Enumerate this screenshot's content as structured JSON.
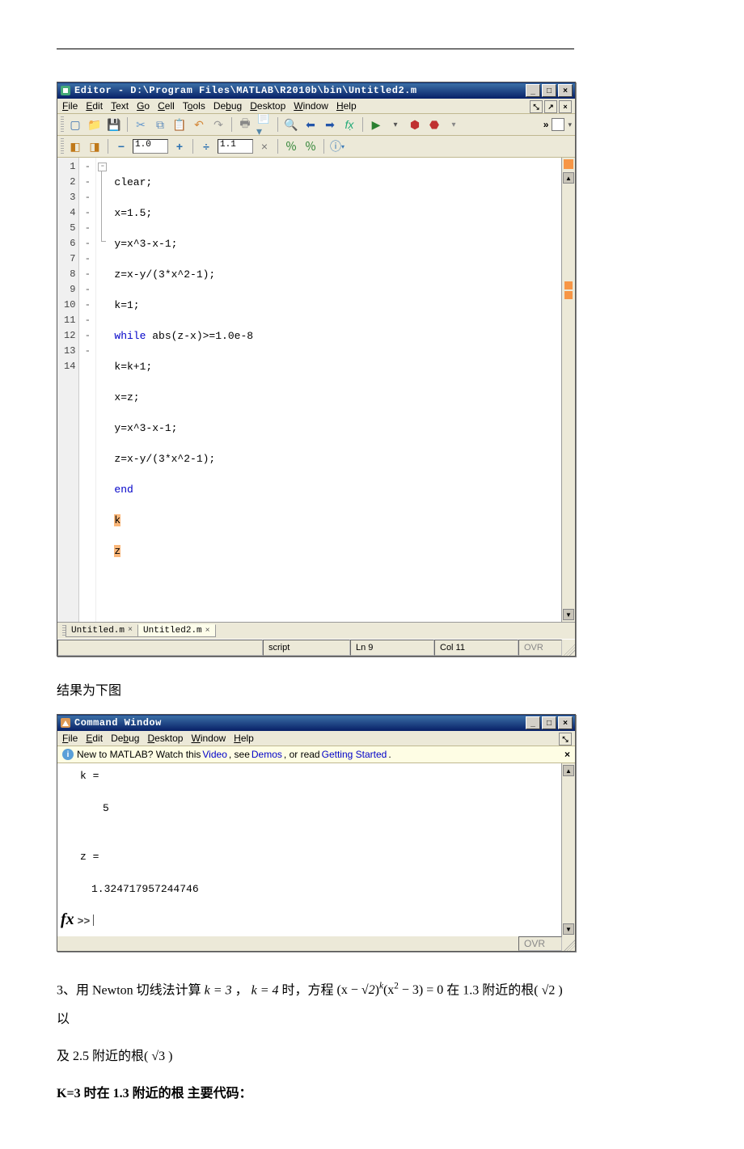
{
  "editor": {
    "title": "Editor - D:\\Program Files\\MATLAB\\R2010b\\bin\\Untitled2.m",
    "menus": [
      "File",
      "Edit",
      "Text",
      "Go",
      "Cell",
      "Tools",
      "Debug",
      "Desktop",
      "Window",
      "Help"
    ],
    "cell_in_1": "1.0",
    "cell_in_2": "1.1",
    "chevron": "»",
    "code_lines": [
      {
        "n": "1",
        "dash": "-",
        "fold": "",
        "text": "clear;",
        "hl": ""
      },
      {
        "n": "2",
        "dash": "-",
        "fold": "",
        "text": "x=1.5;",
        "hl": ""
      },
      {
        "n": "3",
        "dash": "-",
        "fold": "",
        "text": "y=x^3-x-1;",
        "hl": ""
      },
      {
        "n": "4",
        "dash": "-",
        "fold": "",
        "text": "z=x-y/(3*x^2-1);",
        "hl": ""
      },
      {
        "n": "5",
        "dash": "-",
        "fold": "",
        "text": "k=1;",
        "hl": ""
      },
      {
        "n": "6",
        "dash": "-",
        "fold": "⊟",
        "pre": "",
        "kw": "while",
        "post": " abs(z-x)>=1.0e-8",
        "hl": ""
      },
      {
        "n": "7",
        "dash": "-",
        "fold": "│",
        "text": "k=k+1;",
        "hl": ""
      },
      {
        "n": "8",
        "dash": "-",
        "fold": "│",
        "text": "x=z;",
        "hl": ""
      },
      {
        "n": "9",
        "dash": "-",
        "fold": "│",
        "text": "y=x^3-x-1;",
        "hl": ""
      },
      {
        "n": "10",
        "dash": "-",
        "fold": "│",
        "text": "z=x-y/(3*x^2-1);",
        "hl": ""
      },
      {
        "n": "11",
        "dash": "-",
        "fold": "└",
        "pre": "",
        "kw": "end",
        "post": "",
        "hl": ""
      },
      {
        "n": "12",
        "dash": "-",
        "fold": "",
        "text": "k",
        "hl": "k"
      },
      {
        "n": "13",
        "dash": "-",
        "fold": "",
        "text": "z",
        "hl": "z"
      },
      {
        "n": "14",
        "dash": "",
        "fold": "",
        "text": "",
        "hl": ""
      }
    ],
    "tabs": [
      "Untitled.m",
      "Untitled2.m"
    ],
    "status_center": "script",
    "status_ln": "Ln  9",
    "status_col": "Col  11",
    "status_ovr": "OVR"
  },
  "body1": "结果为下图",
  "cmd": {
    "title": "Command Window",
    "menus": [
      "File",
      "Edit",
      "Debug",
      "Desktop",
      "Window",
      "Help"
    ],
    "info_pre": "New to MATLAB? Watch this ",
    "info_link1": "Video",
    "info_mid": ", see ",
    "info_link2": "Demos",
    "info_mid2": ", or read ",
    "info_link3": "Getting Started",
    "info_end": ".",
    "out_k_lbl": "k =",
    "out_k_val": "5",
    "out_z_lbl": "z =",
    "out_z_val": "1.324717957244746",
    "prompt_fx": "fx",
    "prompt_gt": ">>",
    "status_ovr": "OVR"
  },
  "problem3": {
    "text_a": "3、用 Newton 切线法计算 ",
    "k3": "k = 3",
    "comma": "，",
    "k4": "k = 4",
    "text_b": " 时，方程 ",
    "eq_a": "(x − ",
    "eq_sqrt2": "√2",
    "eq_b": ")",
    "eq_exp_k": "k",
    "eq_c": "(x",
    "eq_exp_2": "2",
    "eq_d": " − 3) = 0",
    "text_c": " 在 1.3 附近的根( ",
    "root2": "√2",
    "text_d": " )以",
    "line2_a": "及 2.5 附近的根( ",
    "root3": "√3",
    "line2_b": " )",
    "heading": "K=3 时在 1.3 附近的根    主要代码："
  }
}
